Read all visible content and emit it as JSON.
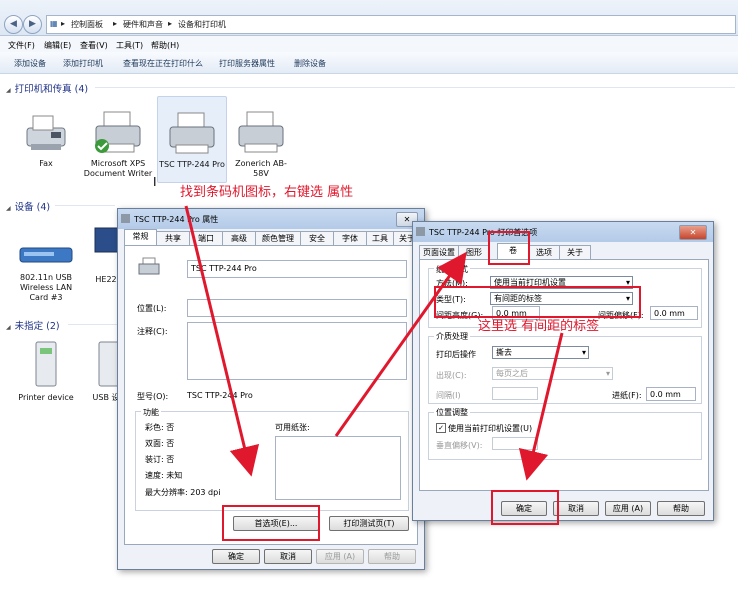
{
  "address": {
    "crumbs": [
      "控制面板",
      "硬件和声音",
      "设备和打印机"
    ],
    "sep": "▸"
  },
  "menu": [
    "文件(F)",
    "编辑(E)",
    "查看(V)",
    "工具(T)",
    "帮助(H)"
  ],
  "commands": [
    "添加设备",
    "添加打印机",
    "查看现在正在打印什么",
    "打印服务器属性",
    "删除设备"
  ],
  "groups": {
    "printers": "打印机和传真 (4)",
    "devices": "设备 (4)",
    "unspecified": "未指定 (2)"
  },
  "printers": [
    {
      "name": "Fax",
      "icon": "fax-icon"
    },
    {
      "name": "Microsoft XPS Document Writer",
      "icon": "printer-icon"
    },
    {
      "name": "TSC TTP-244 Pro",
      "icon": "printer-icon"
    },
    {
      "name": "Zonerich AB-58V",
      "icon": "printer-icon"
    }
  ],
  "devices": [
    {
      "name": "802.11n USB Wireless LAN Card #3",
      "icon": "wifi-adapter-icon"
    },
    {
      "name": "HE22",
      "icon": "monitor-icon"
    }
  ],
  "unspecified": [
    {
      "name": "Printer device",
      "icon": "printer-device-icon"
    },
    {
      "name": "USB 设",
      "icon": "usb-device-icon"
    }
  ],
  "props_dialog": {
    "title": "TSC TTP-244 Pro 属性",
    "tabs": [
      "常规",
      "共享",
      "端口",
      "高级",
      "颜色管理",
      "安全",
      "字体",
      "工具",
      "关于"
    ],
    "printer_name": "TSC TTP-244 Pro",
    "location_label": "位置(L):",
    "comment_label": "注释(C):",
    "model_label": "型号(O):",
    "model_value": "TSC TTP-244 Pro",
    "features_label": "功能",
    "features": [
      "彩色: 否",
      "双面: 否",
      "装订: 否",
      "速度: 未知",
      "最大分辨率: 203 dpi"
    ],
    "paper_label": "可用纸张:",
    "prefs_button": "首选项(E)...",
    "test_button": "打印测试页(T)",
    "ok": "确定",
    "cancel": "取消",
    "apply": "应用 (A)",
    "help": "帮助"
  },
  "prefs_dialog": {
    "title": "TSC TTP-244 Pro 打印首选项",
    "tabs": [
      "页面设置",
      "图形",
      "卷",
      "选项",
      "关于"
    ],
    "format_group": "纸张格式",
    "method_label": "方法(M):",
    "method_value": "使用当前打印机设置",
    "type_label": "类型(T):",
    "type_value": "有间距的标签",
    "gap_label": "间距高度(G):",
    "gap_value": "0.0 mm",
    "offset_label": "间距偏移(F):",
    "offset_value": "0.0 mm",
    "media_group": "介质处理",
    "post_label": "打印后操作",
    "post_value": "撕去",
    "occur_label": "出现(C):",
    "occur_value": "每页之后",
    "interval_label": "间隔(I)",
    "feed_label": "进纸(F):",
    "feed_value": "0.0 mm",
    "pos_group": "位置调整",
    "use_current_cb": "使用当前打印机设置(U)",
    "vert_label": "垂直偏移(V):",
    "ok": "确定",
    "cancel": "取消",
    "apply": "应用 (A)",
    "help": "帮助"
  },
  "annotations": {
    "a1": "找到条码机图标，右键选 属性",
    "a2": "这里选 有间距的标签"
  },
  "accent": "#e0182d"
}
